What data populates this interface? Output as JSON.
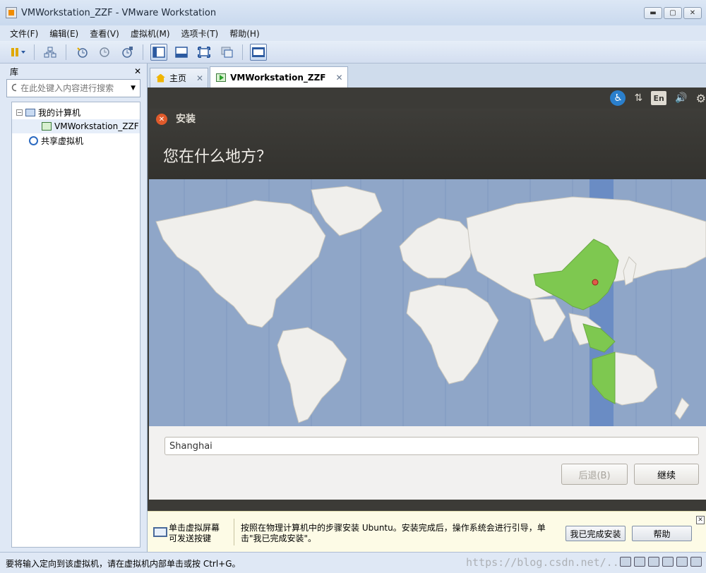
{
  "window": {
    "title": "VMWorkstation_ZZF - VMware Workstation",
    "minimize_glyph": "▬",
    "maximize_glyph": "▢",
    "close_glyph": "✕"
  },
  "menu": [
    "文件(F)",
    "编辑(E)",
    "查看(V)",
    "虚拟机(M)",
    "选项卡(T)",
    "帮助(H)"
  ],
  "library": {
    "title": "库",
    "close_glyph": "✕",
    "search_placeholder": "在此处键入内容进行搜索",
    "tree": {
      "my_computer": "我的计算机",
      "vm_name": "VMWorkstation_ZZF",
      "shared": "共享虚拟机"
    }
  },
  "tabs": [
    {
      "label": "主页",
      "close": "✕"
    },
    {
      "label": "VMWorkstation_ZZF",
      "close": "✕"
    }
  ],
  "ubuntu": {
    "indicators": {
      "access": "♿",
      "network": "⇅",
      "keyboard": "En",
      "sound": "🔊",
      "settings": "⚙"
    },
    "dialog_title": "安装",
    "dialog_close": "✕",
    "question": "您在什么地方？",
    "location_value": "Shanghai",
    "back_button": "后退(B)",
    "continue_button": "继续",
    "selected_timezone_color": "#7ec850",
    "map_ocean_color": "#8fa6c8",
    "map_land_color": "#f0efec",
    "timezone_band_color": "#6a8cc4",
    "marker_color": "#e05a4a"
  },
  "hint_bar": {
    "left_text_line1": "单击虚拟屏幕",
    "left_text_line2": "可发送按键",
    "message": "按照在物理计算机中的步骤安装 Ubuntu。安装完成后，操作系统会进行引导，单击\"我已完成安装\"。",
    "done_button": "我已完成安装",
    "help_button": "帮助",
    "close_glyph": "✕"
  },
  "status_bar": {
    "text": "要将输入定向到该虚拟机，请在虚拟机内部单击或按 Ctrl+G。",
    "watermark": "https://blog.csdn.net/..."
  }
}
